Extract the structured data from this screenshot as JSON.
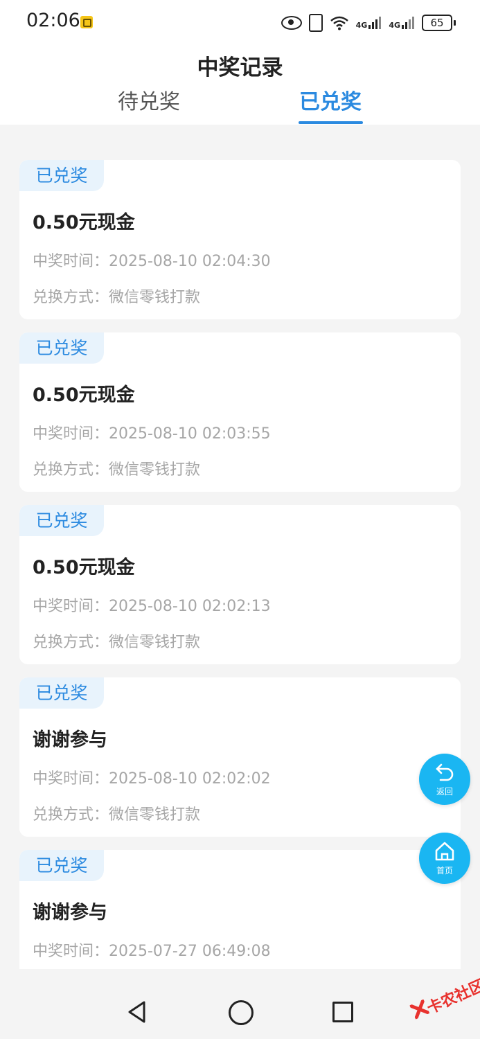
{
  "status_bar": {
    "time": "02:06",
    "signal_1_label": "4G",
    "signal_2_label": "4G",
    "battery": "65"
  },
  "header": {
    "title": "中奖记录",
    "tabs": [
      {
        "label": "待兑奖",
        "active": false
      },
      {
        "label": "已兑奖",
        "active": true
      }
    ]
  },
  "records": [
    {
      "badge": "已兑奖",
      "prize": "0.50元现金",
      "time": "中奖时间：2025-08-10 02:04:30",
      "method": "兑换方式：微信零钱打款"
    },
    {
      "badge": "已兑奖",
      "prize": "0.50元现金",
      "time": "中奖时间：2025-08-10 02:03:55",
      "method": "兑换方式：微信零钱打款"
    },
    {
      "badge": "已兑奖",
      "prize": "0.50元现金",
      "time": "中奖时间：2025-08-10 02:02:13",
      "method": "兑换方式：微信零钱打款"
    },
    {
      "badge": "已兑奖",
      "prize": "谢谢参与",
      "time": "中奖时间：2025-08-10 02:02:02",
      "method": "兑换方式：微信零钱打款"
    },
    {
      "badge": "已兑奖",
      "prize": "谢谢参与",
      "time": "中奖时间：2025-07-27 06:49:08",
      "method": ""
    }
  ],
  "floating": {
    "back_label": "返回",
    "home_label": "首页"
  },
  "watermark": {
    "text": "卡农社区"
  },
  "colors": {
    "accent": "#2b8ae0",
    "fab": "#1ab6f2",
    "badge_bg": "#e8f3fc",
    "background": "#f4f4f4"
  }
}
